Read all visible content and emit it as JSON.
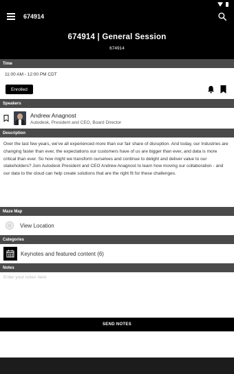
{
  "app_bar": {
    "title": "674914"
  },
  "hero": {
    "title": "674914 | General Session",
    "subtitle": "674914"
  },
  "time": {
    "header": "Time",
    "value": "11:00 AM - 12:00 PM CDT",
    "enrolled_label": "Enrolled"
  },
  "speakers": {
    "header": "Speakers",
    "items": [
      {
        "name": "Andrew Anagnost",
        "role": "Autodesk, President and CEO, Board Director"
      }
    ]
  },
  "description": {
    "header": "Description",
    "text": "Over the last few years, we've all experienced more than our fair share of disruption. And today, our Industries are changing faster than ever, the expectations our customers have of us are bigger than ever, and data is more critical than ever. So how might we transform ourselves and continue to delight and deliver value to our stakeholders? Join Autodesk President and CEO Andrew Anagnost to learn how moving our collaboration - and our data to the cloud can help create solutions that are the right fit for these challenges."
  },
  "maze_map": {
    "header": "Maze Map",
    "label": "View Location"
  },
  "categories": {
    "header": "Categories",
    "label": "Keynotes and featured content (6)"
  },
  "notes": {
    "header": "Notes",
    "placeholder": "Enter your notes here"
  },
  "send_notes_label": "SEND NOTES",
  "icons": {
    "menu": "menu-icon",
    "search": "search-icon",
    "bell": "bell-icon",
    "bookmark": "bookmark-icon",
    "location": "location-icon",
    "calendar": "calendar-icon"
  }
}
